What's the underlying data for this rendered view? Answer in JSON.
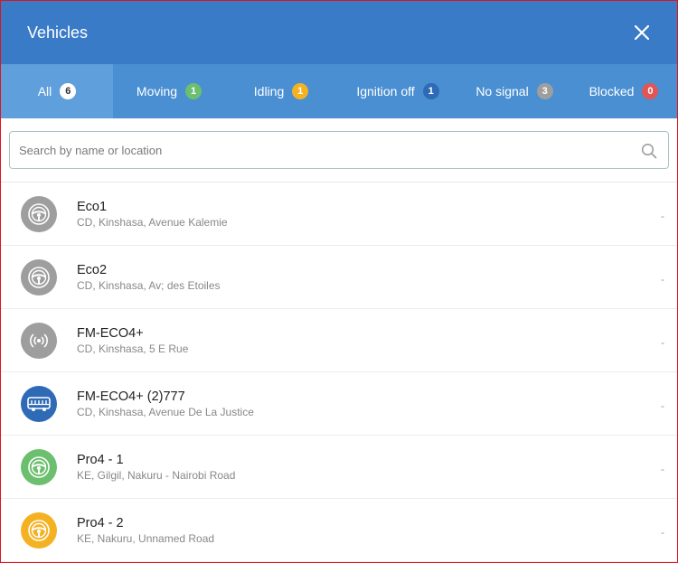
{
  "header": {
    "title": "Vehicles"
  },
  "tabs": [
    {
      "label": "All",
      "count": "6",
      "color": "#ffffff",
      "textColor": "#333333",
      "active": true
    },
    {
      "label": "Moving",
      "count": "1",
      "color": "#6bbf6e",
      "textColor": "#ffffff"
    },
    {
      "label": "Idling",
      "count": "1",
      "color": "#f4b223",
      "textColor": "#ffffff"
    },
    {
      "label": "Ignition off",
      "count": "1",
      "color": "#2f6ab7",
      "textColor": "#ffffff"
    },
    {
      "label": "No signal",
      "count": "3",
      "color": "#9e9e9e",
      "textColor": "#ffffff"
    },
    {
      "label": "Blocked",
      "count": "0",
      "color": "#e05656",
      "textColor": "#ffffff"
    }
  ],
  "search": {
    "placeholder": "Search by name or location",
    "value": ""
  },
  "vehicles": [
    {
      "name": "Eco1",
      "address": "CD, Kinshasa, Avenue Kalemie",
      "status": "-",
      "icon": "steering-wheel-icon",
      "color": "#9e9e9e"
    },
    {
      "name": "Eco2",
      "address": "CD, Kinshasa, Av; des Etoiles",
      "status": "-",
      "icon": "steering-wheel-icon",
      "color": "#9e9e9e"
    },
    {
      "name": "FM-ECO4+",
      "address": "CD, Kinshasa, 5 E Rue",
      "status": "-",
      "icon": "signal-icon",
      "color": "#9e9e9e"
    },
    {
      "name": "FM-ECO4+ (2)777",
      "address": "CD, Kinshasa, Avenue De La Justice",
      "status": "-",
      "icon": "bus-icon",
      "color": "#2f6ab7"
    },
    {
      "name": "Pro4 - 1",
      "address": "KE, Gilgil, Nakuru - Nairobi Road",
      "status": "-",
      "icon": "steering-wheel-icon",
      "color": "#6bbf6e"
    },
    {
      "name": "Pro4 - 2",
      "address": "KE, Nakuru, Unnamed Road",
      "status": "-",
      "icon": "steering-wheel-icon",
      "color": "#f4b223"
    }
  ]
}
